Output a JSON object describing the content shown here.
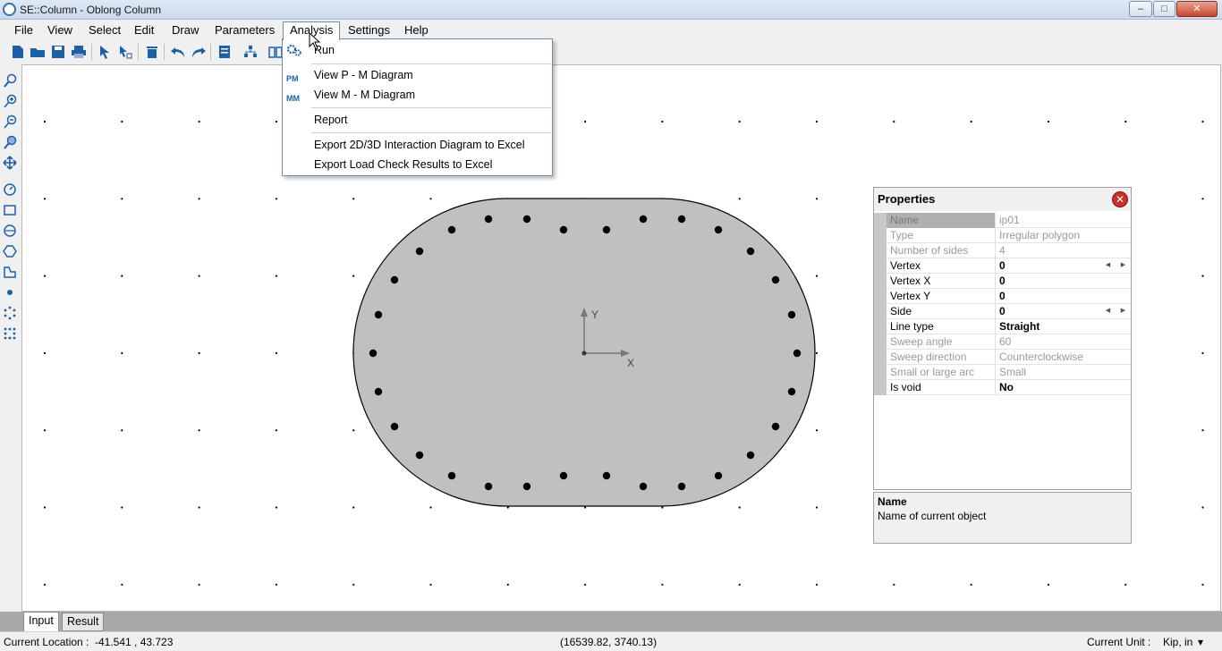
{
  "window": {
    "title": "SE::Column - Oblong Column",
    "minimize": "–",
    "maximize": "□",
    "close": "✕"
  },
  "menu": [
    {
      "label": "File"
    },
    {
      "label": "View"
    },
    {
      "label": "Select"
    },
    {
      "label": "Edit"
    },
    {
      "label": "Draw"
    },
    {
      "label": "Parameters"
    },
    {
      "label": "Analysis"
    },
    {
      "label": "Settings"
    },
    {
      "label": "Help"
    }
  ],
  "analysis_menu": {
    "run": "Run",
    "pm_icon": "PM",
    "pm_diagram": "View P - M Diagram",
    "mm_icon": "MM",
    "mm_diagram": "View M - M Diagram",
    "report": "Report",
    "export_interaction": "Export 2D/3D Interaction Diagram to Excel",
    "export_load_check": "Export Load Check Results to Excel"
  },
  "canvas": {
    "axis_x": "X",
    "axis_y": "Y"
  },
  "properties": {
    "title": "Properties",
    "close_icon": "✕",
    "rows": [
      {
        "name": "Name",
        "value": "ip01"
      },
      {
        "name": "Type",
        "value": "Irregular polygon"
      },
      {
        "name": "Number of sides",
        "value": "4"
      },
      {
        "name": "Vertex",
        "value": "0"
      },
      {
        "name": "Vertex X",
        "value": "0"
      },
      {
        "name": "Vertex Y",
        "value": "0"
      },
      {
        "name": "Side",
        "value": "0"
      },
      {
        "name": "Line type",
        "value": "Straight"
      },
      {
        "name": "Sweep angle",
        "value": "60"
      },
      {
        "name": "Sweep direction",
        "value": "Counterclockwise"
      },
      {
        "name": "Small or large arc",
        "value": "Small"
      },
      {
        "name": "Is void",
        "value": "No"
      }
    ],
    "spin_left": "◀",
    "spin_right": "▶"
  },
  "description": {
    "title": "Name",
    "text": "Name of current object"
  },
  "tabs": {
    "input": "Input",
    "result": "Result"
  },
  "status": {
    "location_label": "Current Location :",
    "location_value": "-41.541 , 43.723",
    "coords": "(16539.82, 3740.13)",
    "unit_label": "Current Unit :",
    "unit_value": "Kip, in",
    "unit_arrow": "▾"
  },
  "colors": {
    "section_fill": "#c0c0c0",
    "rebar": "#000000",
    "accent": "#1f5fa8"
  }
}
